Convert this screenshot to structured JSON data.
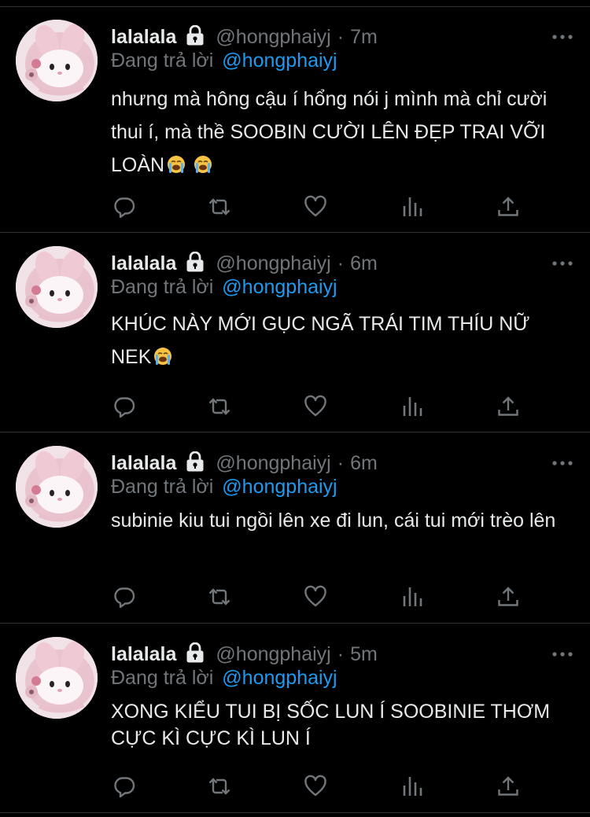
{
  "tweets": [
    {
      "name": "lalalala",
      "handle": "@hongphaiyj",
      "sep": "·",
      "time": "7m",
      "reply_label": "Đang trả lời",
      "reply_to": "@hongphaiyj",
      "text": "nhưng mà hông cậu í hổng nói j mình mà chỉ cười thui í, mà thề SOOBIN CƯỜI LÊN ĐẸP TRAI VỠI LOÀN",
      "emojis": [
        "loudly-crying-face-icon",
        "loudly-crying-face-icon"
      ]
    },
    {
      "name": "lalalala",
      "handle": "@hongphaiyj",
      "sep": "·",
      "time": "6m",
      "reply_label": "Đang trả lời",
      "reply_to": "@hongphaiyj",
      "text": "KHÚC NÀY MỚI GỤC NGÃ TRÁI TIM THÍU NỮ NEK",
      "emojis": [
        "loudly-crying-face-icon"
      ]
    },
    {
      "name": "lalalala",
      "handle": "@hongphaiyj",
      "sep": "·",
      "time": "6m",
      "reply_label": "Đang trả lời",
      "reply_to": "@hongphaiyj",
      "text": "subinie kiu tui ngồi lên xe đi lun, cái tui mới trèo lên",
      "emojis": []
    },
    {
      "name": "lalalala",
      "handle": "@hongphaiyj",
      "sep": "·",
      "time": "5m",
      "reply_label": "Đang trả lời",
      "reply_to": "@hongphaiyj",
      "text": "XONG KIỂU TUI BỊ SỐC LUN Í SOOBINIE THƠM CỰC KÌ CỰC KÌ LUN Í",
      "emojis": []
    }
  ],
  "icons": {
    "lock": "lock-icon",
    "more": "more-dots-icon",
    "reply": "reply-icon",
    "retweet": "retweet-icon",
    "like": "heart-icon",
    "views": "views-chart-icon",
    "share": "share-icon"
  },
  "colors": {
    "background": "#000000",
    "text": "#e7e9ea",
    "muted": "#71767b",
    "link": "#1d9bf0",
    "divider": "#2f3336"
  }
}
